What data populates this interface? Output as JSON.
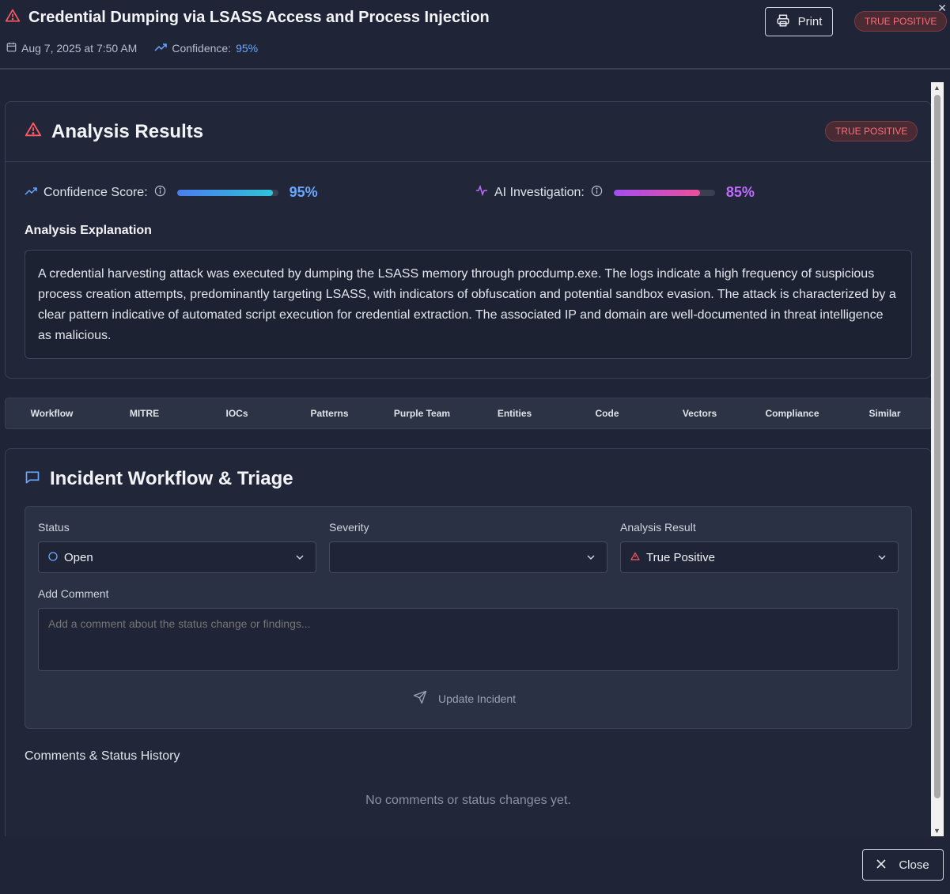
{
  "header": {
    "title": "Credential Dumping via LSASS Access and Process Injection",
    "date": "Aug 7, 2025 at 7:50 AM",
    "confidence_label": "Confidence:",
    "confidence_value": "95%",
    "print_label": "Print",
    "badge": "TRUE POSITIVE",
    "close_x": "✕"
  },
  "analysis": {
    "title": "Analysis Results",
    "badge": "TRUE POSITIVE",
    "confidence_label": "Confidence Score:",
    "confidence_value": "95%",
    "confidence_fraction": 0.95,
    "ai_label": "AI Investigation:",
    "ai_value": "85%",
    "ai_fraction": 0.85,
    "explanation_label": "Analysis Explanation",
    "explanation": "A credential harvesting attack was executed by dumping the LSASS memory through procdump.exe. The logs indicate a high frequency of suspicious process creation attempts, predominantly targeting LSASS, with indicators of obfuscation and potential sandbox evasion. The attack is characterized by a clear pattern indicative of automated script execution for credential extraction. The associated IP and domain are well-documented in threat intelligence as malicious."
  },
  "tabs": [
    "Workflow",
    "MITRE",
    "IOCs",
    "Patterns",
    "Purple Team",
    "Entities",
    "Code",
    "Vectors",
    "Compliance",
    "Similar"
  ],
  "workflow": {
    "title": "Incident Workflow & Triage",
    "status_label": "Status",
    "status_value": "Open",
    "severity_label": "Severity",
    "severity_value": "",
    "result_label": "Analysis Result",
    "result_value": "True Positive",
    "comment_label": "Add Comment",
    "comment_placeholder": "Add a comment about the status change or findings...",
    "update_label": "Update Incident",
    "history_label": "Comments & Status History",
    "empty_text": "No comments or status changes yet."
  },
  "footer": {
    "close_label": "Close"
  },
  "colors": {
    "danger": "#ff5a66",
    "blue": "#6aa8ff",
    "purple": "#c06cff"
  }
}
